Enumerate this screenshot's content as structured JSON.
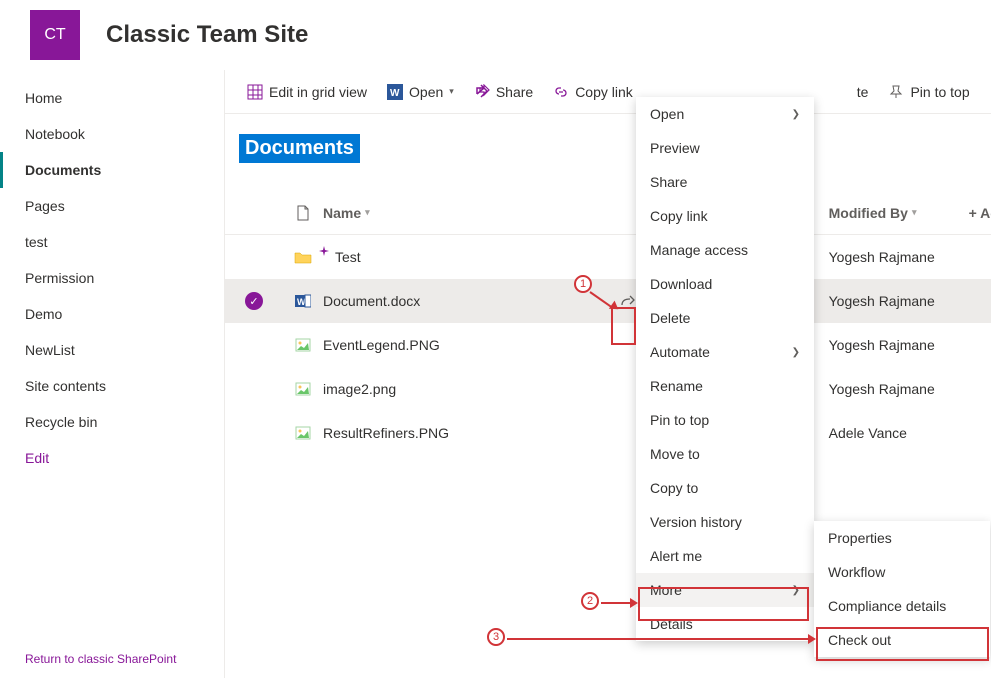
{
  "site": {
    "logo_text": "CT",
    "title": "Classic Team Site"
  },
  "sidebar": {
    "items": [
      {
        "label": "Home"
      },
      {
        "label": "Notebook"
      },
      {
        "label": "Documents"
      },
      {
        "label": "Pages"
      },
      {
        "label": "test"
      },
      {
        "label": "Permission"
      },
      {
        "label": "Demo"
      },
      {
        "label": "NewList"
      },
      {
        "label": "Site contents"
      },
      {
        "label": "Recycle bin"
      }
    ],
    "edit_label": "Edit",
    "return_label": "Return to classic SharePoint"
  },
  "toolbar": {
    "edit_grid": "Edit in grid view",
    "open": "Open",
    "share": "Share",
    "copy_link": "Copy link",
    "delete_partial": "te",
    "pin": "Pin to top"
  },
  "library": {
    "title": "Documents"
  },
  "columns": {
    "name": "Name",
    "modified_by": "Modified By",
    "add": "+  Ad"
  },
  "files": [
    {
      "name": "Test",
      "type": "folder",
      "modified_by": "Yogesh Rajmane"
    },
    {
      "name": "Document.docx",
      "type": "docx",
      "modified_by": "Yogesh Rajmane"
    },
    {
      "name": "EventLegend.PNG",
      "type": "image",
      "modified_by": "Yogesh Rajmane"
    },
    {
      "name": "image2.png",
      "type": "image",
      "modified_by": "Yogesh Rajmane"
    },
    {
      "name": "ResultRefiners.PNG",
      "type": "image",
      "modified_by": "Adele Vance"
    }
  ],
  "context_menu": {
    "open": "Open",
    "preview": "Preview",
    "share": "Share",
    "copy_link": "Copy link",
    "manage_access": "Manage access",
    "download": "Download",
    "delete": "Delete",
    "automate": "Automate",
    "rename": "Rename",
    "pin": "Pin to top",
    "move": "Move to",
    "copy": "Copy to",
    "version": "Version history",
    "alert": "Alert me",
    "more": "More",
    "details": "Details"
  },
  "submenu": {
    "properties": "Properties",
    "workflow": "Workflow",
    "compliance": "Compliance details",
    "checkout": "Check out"
  },
  "annotations": {
    "a1": "1",
    "a2": "2",
    "a3": "3"
  }
}
